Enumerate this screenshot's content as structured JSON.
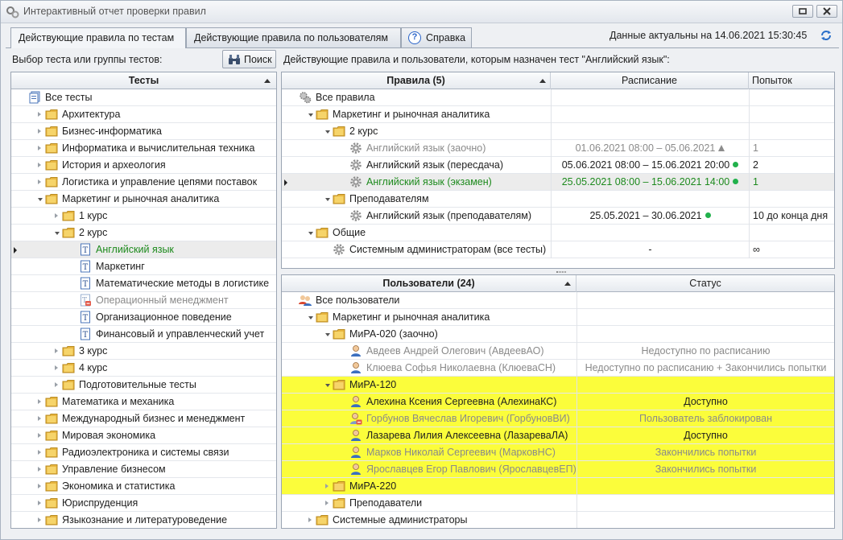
{
  "window": {
    "title": "Интерактивный отчет проверки правил",
    "refresh_icon": "refresh-icon"
  },
  "tabs": [
    {
      "label": "Действующие правила по тестам"
    },
    {
      "label": "Действующие правила по пользователям"
    },
    {
      "label": "Справка"
    }
  ],
  "header": {
    "data_actual": "Данные актуальны на 14.06.2021 15:30:45"
  },
  "left": {
    "select_label": "Выбор теста или группы тестов:",
    "search_label": "Поиск",
    "column": "Тесты",
    "rows": [
      {
        "text": "Все тесты",
        "icon": "tests-root-icon",
        "depth": 0,
        "exp": ""
      },
      {
        "text": "Архитектура",
        "icon": "folder-icon",
        "depth": 1,
        "exp": "closed"
      },
      {
        "text": "Бизнес-информатика",
        "icon": "folder-icon",
        "depth": 1,
        "exp": "closed"
      },
      {
        "text": "Информатика и вычислительная техника",
        "icon": "folder-icon",
        "depth": 1,
        "exp": "closed"
      },
      {
        "text": "История и археология",
        "icon": "folder-icon",
        "depth": 1,
        "exp": "closed"
      },
      {
        "text": "Логистика и управление цепями поставок",
        "icon": "folder-icon",
        "depth": 1,
        "exp": "closed"
      },
      {
        "text": "Маркетинг и рыночная аналитика",
        "icon": "folder-icon",
        "depth": 1,
        "exp": "open"
      },
      {
        "text": "1 курс",
        "icon": "folder-icon",
        "depth": 2,
        "exp": "closed"
      },
      {
        "text": "2 курс",
        "icon": "folder-icon",
        "depth": 2,
        "exp": "open"
      },
      {
        "text": "Английский язык",
        "icon": "test-icon",
        "depth": 3,
        "exp": "",
        "style": "green",
        "selected": true
      },
      {
        "text": "Маркетинг",
        "icon": "test-icon",
        "depth": 3,
        "exp": ""
      },
      {
        "text": "Математические методы в логистике",
        "icon": "test-icon",
        "depth": 3,
        "exp": ""
      },
      {
        "text": "Операционный менеджмент",
        "icon": "test-disabled-icon",
        "depth": 3,
        "exp": "",
        "style": "grey"
      },
      {
        "text": "Организационное поведение",
        "icon": "test-icon",
        "depth": 3,
        "exp": ""
      },
      {
        "text": "Финансовый и управленческий учет",
        "icon": "test-icon",
        "depth": 3,
        "exp": ""
      },
      {
        "text": "3 курс",
        "icon": "folder-icon",
        "depth": 2,
        "exp": "closed"
      },
      {
        "text": "4 курс",
        "icon": "folder-icon",
        "depth": 2,
        "exp": "closed"
      },
      {
        "text": "Подготовительные тесты",
        "icon": "folder-icon",
        "depth": 2,
        "exp": "closed"
      },
      {
        "text": "Математика и механика",
        "icon": "folder-icon",
        "depth": 1,
        "exp": "closed"
      },
      {
        "text": "Международный бизнес и менеджмент",
        "icon": "folder-icon",
        "depth": 1,
        "exp": "closed"
      },
      {
        "text": "Мировая экономика",
        "icon": "folder-icon",
        "depth": 1,
        "exp": "closed"
      },
      {
        "text": "Радиоэлектроника и системы связи",
        "icon": "folder-icon",
        "depth": 1,
        "exp": "closed"
      },
      {
        "text": "Управление бизнесом",
        "icon": "folder-icon",
        "depth": 1,
        "exp": "closed"
      },
      {
        "text": "Экономика и статистика",
        "icon": "folder-icon",
        "depth": 1,
        "exp": "closed"
      },
      {
        "text": "Юриспруденция",
        "icon": "folder-icon",
        "depth": 1,
        "exp": "closed"
      },
      {
        "text": "Языкознание и литературоведение",
        "icon": "folder-icon",
        "depth": 1,
        "exp": "closed"
      }
    ]
  },
  "right": {
    "title": "Действующие правила и пользователи, которым назначен тест \"Английский язык\":",
    "rules": {
      "columns": [
        "Правила (5)",
        "Расписание",
        "Попыток"
      ],
      "rows": [
        {
          "text": "Все правила",
          "icon": "rules-root-icon",
          "depth": 0,
          "exp": "",
          "schedule": "",
          "attempts": ""
        },
        {
          "text": "Маркетинг и рыночная аналитика",
          "icon": "folder-icon",
          "depth": 1,
          "exp": "open",
          "schedule": "",
          "attempts": ""
        },
        {
          "text": "2 курс",
          "icon": "folder-icon",
          "depth": 2,
          "exp": "open",
          "schedule": "",
          "attempts": ""
        },
        {
          "text": "Английский язык (заочно)",
          "icon": "rule-gear-icon",
          "depth": 3,
          "exp": "",
          "style": "grey",
          "schedule": "01.06.2021 08:00 – 05.06.2021",
          "mark": "warn",
          "attempts": "1"
        },
        {
          "text": "Английский язык (пересдача)",
          "icon": "rule-gear-icon",
          "depth": 3,
          "exp": "",
          "schedule": "05.06.2021 08:00 – 15.06.2021 20:00",
          "mark": "dot",
          "attempts": "2"
        },
        {
          "text": "Английский язык (экзамен)",
          "icon": "rule-gear-icon",
          "depth": 3,
          "exp": "",
          "style": "green",
          "selected": true,
          "schedule": "25.05.2021 08:00 – 15.06.2021 14:00",
          "mark": "dot",
          "attempts": "1"
        },
        {
          "text": "Преподавателям",
          "icon": "folder-icon",
          "depth": 2,
          "exp": "open",
          "schedule": "",
          "attempts": ""
        },
        {
          "text": "Английский язык (преподавателям)",
          "icon": "rule-gear-icon",
          "depth": 3,
          "exp": "",
          "schedule": "25.05.2021 – 30.06.2021",
          "mark": "dot",
          "attempts": "10 до конца дня"
        },
        {
          "text": "Общие",
          "icon": "folder-icon",
          "depth": 1,
          "exp": "open",
          "schedule": "",
          "attempts": ""
        },
        {
          "text": "Системным администраторам (все тесты)",
          "icon": "rule-gear-icon",
          "depth": 2,
          "exp": "",
          "schedule": "-",
          "attempts": "∞"
        }
      ]
    },
    "users": {
      "columns": [
        "Пользователи (24)",
        "Статус"
      ],
      "rows": [
        {
          "text": "Все пользователи",
          "icon": "users-root-icon",
          "depth": 0,
          "exp": "",
          "status": ""
        },
        {
          "text": "Маркетинг и рыночная аналитика",
          "icon": "folder-icon",
          "depth": 1,
          "exp": "open",
          "status": ""
        },
        {
          "text": "МиРА-020 (заочно)",
          "icon": "folder-icon",
          "depth": 2,
          "exp": "open",
          "status": ""
        },
        {
          "text": "Авдеев Андрей Олегович (АвдеевАО)",
          "icon": "user-icon",
          "depth": 3,
          "exp": "",
          "style": "grey",
          "status": "Недоступно по расписанию"
        },
        {
          "text": "Клюева Софья Николаевна (КлюеваСН)",
          "icon": "user-icon",
          "depth": 3,
          "exp": "",
          "style": "grey",
          "status": "Недоступно по расписанию + Закончились попытки"
        },
        {
          "text": "МиРА-120",
          "icon": "folder-icon",
          "depth": 2,
          "exp": "open",
          "yellow": true,
          "status": ""
        },
        {
          "text": "Алехина Ксения Сергеевна (АлехинаКС)",
          "icon": "user-icon",
          "depth": 3,
          "exp": "",
          "yellow": true,
          "status": "Доступно"
        },
        {
          "text": "Горбунов Вячеслав Игоревич (ГорбуновВИ)",
          "icon": "user-blocked-icon",
          "depth": 3,
          "exp": "",
          "style": "grey",
          "yellow": true,
          "status": "Пользователь заблокирован"
        },
        {
          "text": "Лазарева Лилия Алексеевна (ЛазареваЛА)",
          "icon": "user-icon",
          "depth": 3,
          "exp": "",
          "yellow": true,
          "status": "Доступно"
        },
        {
          "text": "Марков Николай Сергеевич (МарковНС)",
          "icon": "user-icon",
          "depth": 3,
          "exp": "",
          "style": "grey",
          "yellow": true,
          "status": "Закончились попытки"
        },
        {
          "text": "Ярославцев Егор Павлович (ЯрославцевЕП)",
          "icon": "user-icon",
          "depth": 3,
          "exp": "",
          "style": "grey",
          "yellow": true,
          "status": "Закончились попытки"
        },
        {
          "text": "МиРА-220",
          "icon": "folder-icon",
          "depth": 2,
          "exp": "closed",
          "yellow": true,
          "status": ""
        },
        {
          "text": "Преподаватели",
          "icon": "folder-icon",
          "depth": 2,
          "exp": "closed",
          "status": ""
        },
        {
          "text": "Системные администраторы",
          "icon": "folder-icon",
          "depth": 1,
          "exp": "closed",
          "status": ""
        }
      ]
    }
  }
}
